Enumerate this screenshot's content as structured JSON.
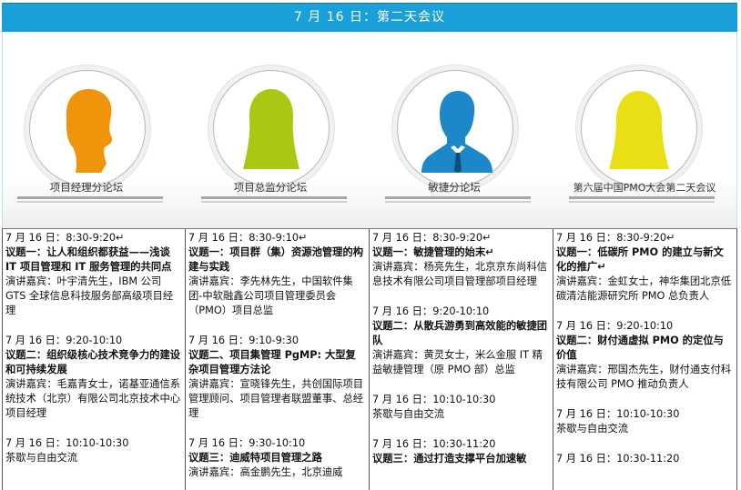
{
  "banner": {
    "title": "7 月 16 日：第二天会议"
  },
  "forums": [
    {
      "title": "项目经理分论坛",
      "color": "#f0940c",
      "icon": "male-head-icon"
    },
    {
      "title": "项目总监分论坛",
      "color": "#a8c814",
      "icon": "female-head-icon"
    },
    {
      "title": "敏捷分论坛",
      "color": "#1c87c9",
      "icon": "businessman-icon"
    },
    {
      "title": "第六届中国PMO大会第二天会议",
      "color": "#e8e014",
      "icon": "female-head-icon"
    }
  ],
  "columns": [
    {
      "sessions": [
        {
          "time": "7 月 16 日：8:30-9:20↵",
          "topic": "议题一：让人和组织都获益——浅谈 IT 项目管理和 IT 服务管理的共同点",
          "speaker": "演讲嘉宾：叶宇清先生，IBM 公司 GTS 全球信息科技服务部高级项目经理"
        },
        {
          "time": "7 月 16 日：9:20-10:10",
          "topic": "议题二：组织级核心技术竞争力的建设和可持续发展",
          "speaker": "演讲嘉宾：毛嘉青女士，诺基亚通信系统技术（北京）有限公司北京技术中心项目经理"
        },
        {
          "time": "7 月 16 日：10:10-10:30",
          "topic": "",
          "speaker": "茶歇与自由交流"
        }
      ]
    },
    {
      "sessions": [
        {
          "time": "7 月 16 日：8:30-9:10↵",
          "topic": "议题一：项目群（集）资源池管理的构建与实践",
          "speaker": "演讲嘉宾：李先林先生，中国软件集团-中软融鑫公司项目管理委员会（PMO）项目总监"
        },
        {
          "time": "7 月 16 日：9:10-9:30",
          "topic": "议题二、项目集管理 PgMP: 大型复杂项目管理方法论",
          "speaker": "演讲嘉宾：宣晓锋先生，共创国际项目管理顾问、项目管理者联盟董事、总经理"
        },
        {
          "time": "7 月 16 日：9:30-10:10",
          "topic": "议题三：迪威特项目管理之路",
          "speaker": "演讲嘉宾：高金鹏先生，北京迪威"
        }
      ]
    },
    {
      "sessions": [
        {
          "time": "7 月 16 日：8:30-9:20↵",
          "topic": "议题一：敏捷管理的始末↵",
          "speaker": "演讲嘉宾：杨亮先生，北京京东尚科信息技术有限公司项目管理部项目经理"
        },
        {
          "time": "7 月 16 日：9:20-10:10",
          "topic": "议题二：从散兵游勇到高效能的敏捷团队",
          "speaker": "演讲嘉宾：黄灵女士，米么金服 IT 精益敏捷管理（原 PMO 部）总监"
        },
        {
          "time": "7 月 16 日：10:10-10:30",
          "topic": "",
          "speaker": "茶歇与自由交流"
        },
        {
          "time": "7 月 16 日：10:30-11:20",
          "topic": "议题三：通过打造支撑平台加速敏",
          "speaker": ""
        }
      ]
    },
    {
      "sessions": [
        {
          "time": "7 月 16 日：8:30-9:20↵",
          "topic": "议题一：低碳所 PMO 的建立与新文化的推广↵",
          "speaker": "演讲嘉宾：金虹女士，神华集团北京低碳清洁能源研究所 PMO 总负责人"
        },
        {
          "time": "7 月 16 日：9:20-10:10",
          "topic": "议题二：财付通虚拟 PMO 的定位与价值",
          "speaker": "演讲嘉宾：邢国杰先生，财付通支付科技有限公司 PMO 推动负责人"
        },
        {
          "time": "7 月 16 日：10:10-10:30",
          "topic": "",
          "speaker": "茶歇与自由交流"
        },
        {
          "time": "7 月 16 日：10:30-11:20",
          "topic": "",
          "speaker": ""
        }
      ]
    }
  ]
}
